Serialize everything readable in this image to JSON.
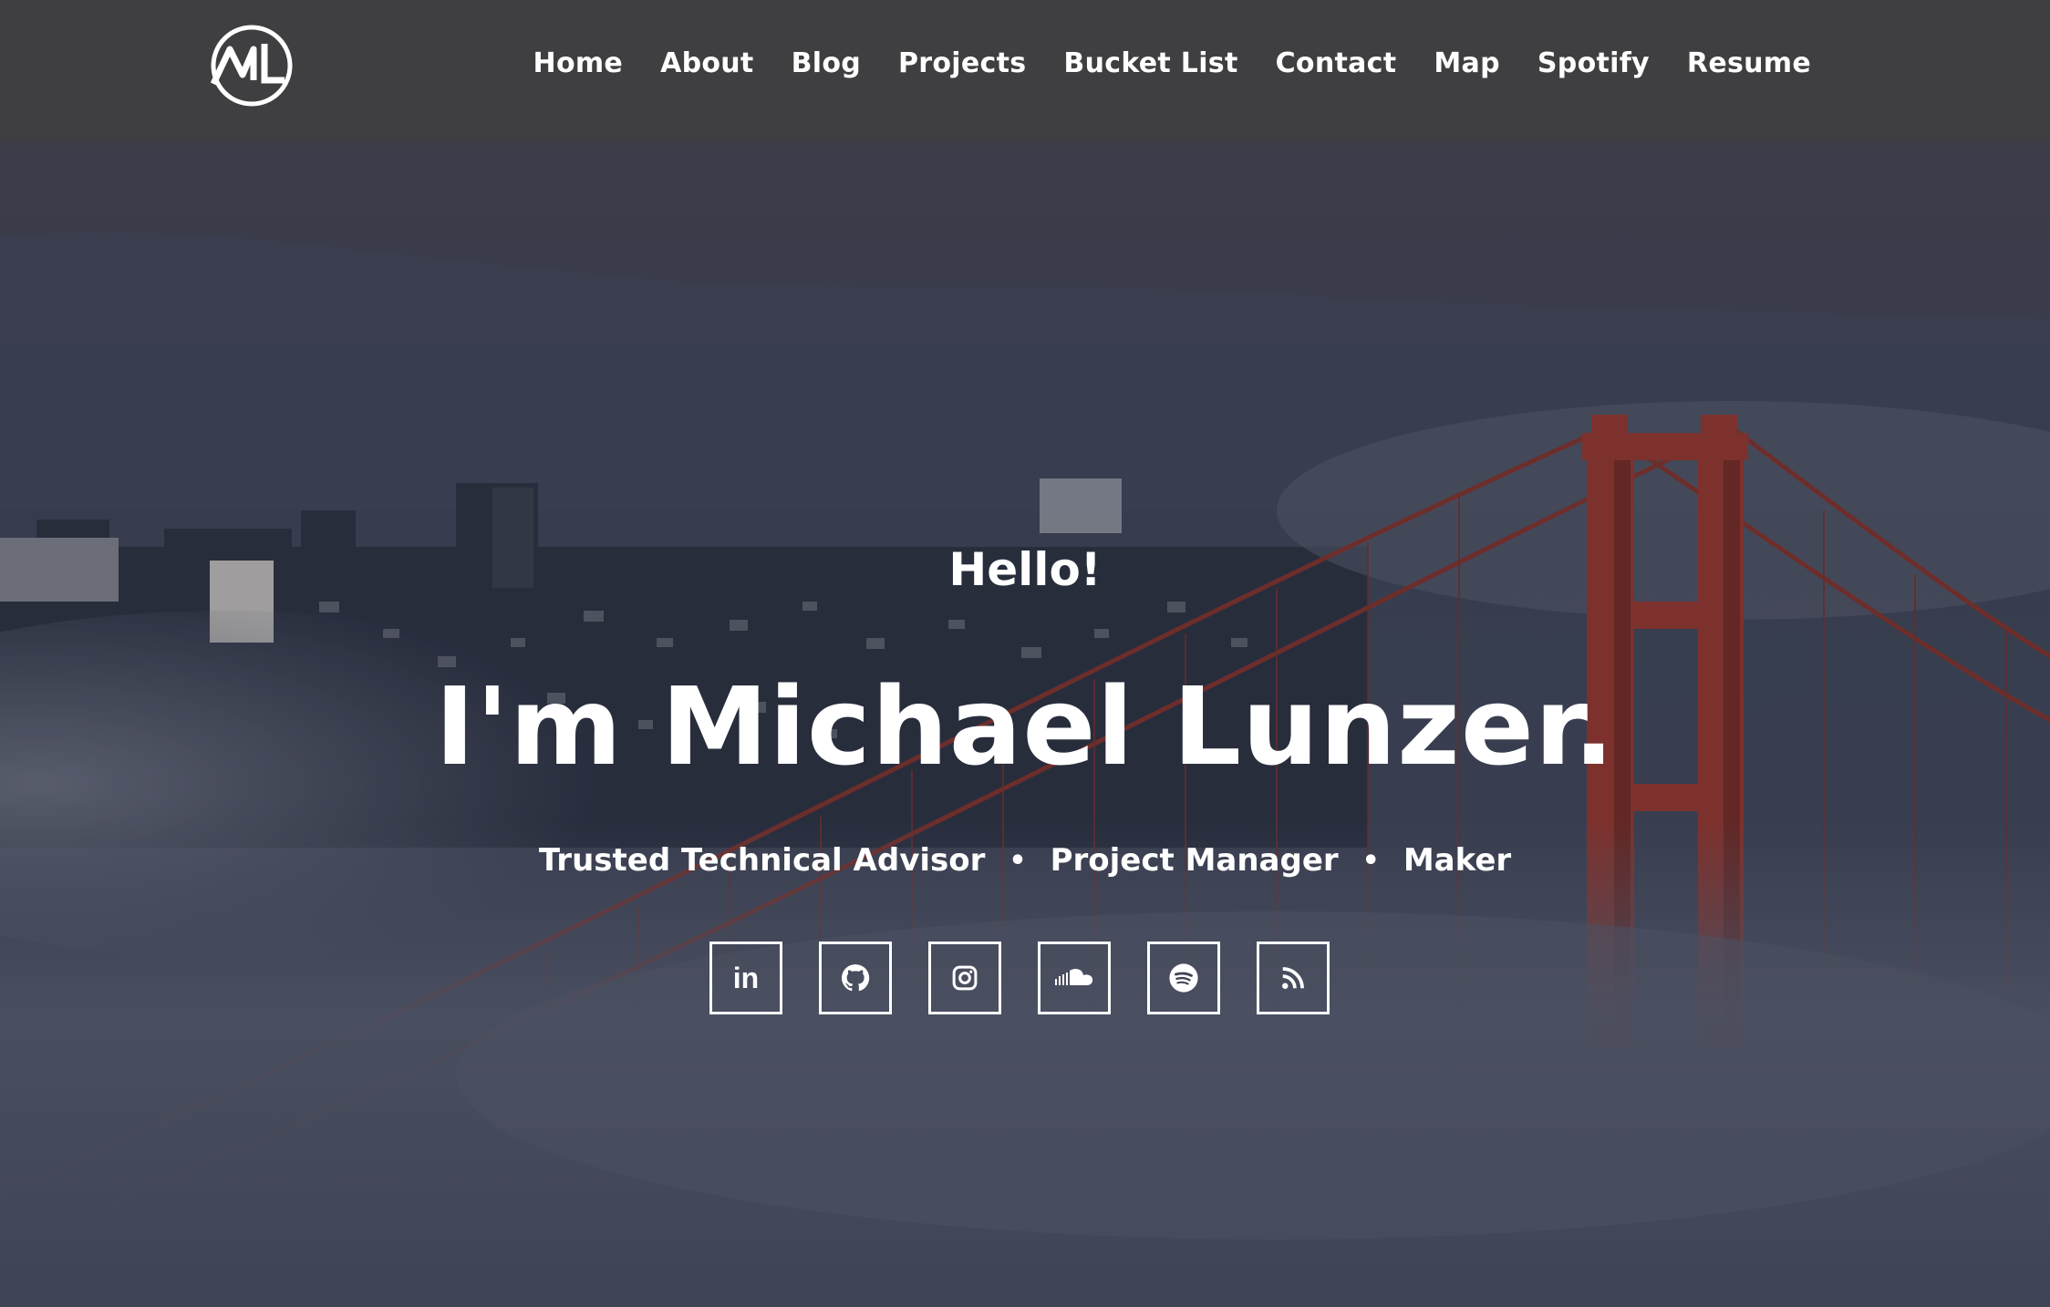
{
  "site": {
    "logo_text": "ML",
    "accent": "#b33b2c",
    "nav_bg": "#3f3f41"
  },
  "nav": {
    "items": [
      {
        "label": "Home"
      },
      {
        "label": "About"
      },
      {
        "label": "Blog"
      },
      {
        "label": "Projects"
      },
      {
        "label": "Bucket List"
      },
      {
        "label": "Contact"
      },
      {
        "label": "Map"
      },
      {
        "label": "Spotify"
      },
      {
        "label": "Resume"
      }
    ]
  },
  "hero": {
    "greeting": "Hello!",
    "headline": "I'm Michael Lunzer.",
    "roles": [
      "Trusted Technical Advisor",
      "Project Manager",
      "Maker"
    ],
    "separator": "•",
    "background": "foggy-golden-gate-bridge-photo"
  },
  "socials": [
    {
      "icon": "linkedin-icon",
      "glyph": "in"
    },
    {
      "icon": "github-icon"
    },
    {
      "icon": "instagram-icon"
    },
    {
      "icon": "soundcloud-icon"
    },
    {
      "icon": "spotify-icon"
    },
    {
      "icon": "rss-icon"
    }
  ]
}
